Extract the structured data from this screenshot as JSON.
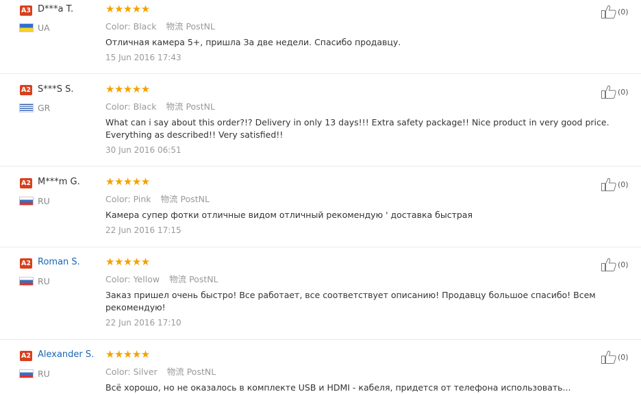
{
  "reviews": [
    {
      "badge": "A3",
      "name": "D***a T.",
      "name_link": false,
      "country": "UA",
      "color_label": "Color:",
      "color": "Black",
      "logistics_label": "物流",
      "logistics": "PostNL",
      "text": "Отличная камера 5+, пришла За две недели. Спасибо продавцу.",
      "date": "15 Jun 2016 17:43",
      "helpful_count": "(0)",
      "rating": 5
    },
    {
      "badge": "A2",
      "name": "S***S S.",
      "name_link": false,
      "country": "GR",
      "color_label": "Color:",
      "color": "Black",
      "logistics_label": "物流",
      "logistics": "PostNL",
      "text": "What can i say about this order?!? Delivery in only 13 days!!! Extra safety package!! Nice product in very good price. Everything as described!! Very satisfied!!",
      "date": "30 Jun 2016 06:51",
      "helpful_count": "(0)",
      "rating": 5
    },
    {
      "badge": "A2",
      "name": "M***m G.",
      "name_link": false,
      "country": "RU",
      "color_label": "Color:",
      "color": "Pink",
      "logistics_label": "物流",
      "logistics": "PostNL",
      "text": "Камера супер фотки отличные видом отличный рекомендую ' доставка быстрая",
      "date": "22 Jun 2016 17:15",
      "helpful_count": "(0)",
      "rating": 5
    },
    {
      "badge": "A2",
      "name": "Roman S.",
      "name_link": true,
      "country": "RU",
      "color_label": "Color:",
      "color": "Yellow",
      "logistics_label": "物流",
      "logistics": "PostNL",
      "text": "Заказ пришел очень быстро! Все работает, все соответствует описанию! Продавцу большое спасибо! Всем рекомендую!",
      "date": "22 Jun 2016 17:10",
      "helpful_count": "(0)",
      "rating": 5
    },
    {
      "badge": "A2",
      "name": "Alexander S.",
      "name_link": true,
      "country": "RU",
      "color_label": "Color:",
      "color": "Silver",
      "logistics_label": "物流",
      "logistics": "PostNL",
      "text": "Всё хорошо, но не оказалось в комплекте USB и HDMI - кабеля, придется от телефона использовать...",
      "date": "",
      "helpful_count": "(0)",
      "rating": 5
    }
  ],
  "colors": {
    "badge": "#d8401d",
    "star": "#f4a100",
    "link": "#1965b2",
    "muted": "#999999"
  },
  "icons": {
    "rating": "star-icon",
    "helpful": "thumbs-up-icon",
    "flag": "country-flag-icon"
  }
}
